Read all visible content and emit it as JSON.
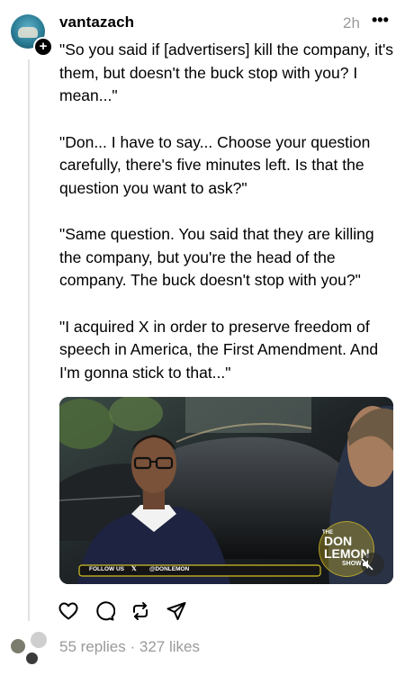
{
  "post": {
    "username": "vantazach",
    "time": "2h",
    "more_icon": "•••",
    "add_icon": "+",
    "paragraphs": [
      "\"So you said if [advertisers] kill the company, it's them, but doesn't the buck stop with you? I mean...\"",
      "\"Don... I have to say... Choose your question carefully, there's five minutes left. Is that the question you want to ask?\"",
      "\"Same question. You said that they are killing the company, but you're the head of the company. The buck doesn't stop with you?\"",
      "\"I acquired X in order to preserve freedom of speech in America, the First Amendment. And I'm gonna stick to that...\""
    ],
    "video": {
      "banner_follow": "FOLLOW US",
      "banner_handle": "@DONLEMON",
      "logo_the": "THE",
      "logo_don": "DON",
      "logo_lemon": "LEMON",
      "logo_show": "SHOW",
      "muted": true
    },
    "replies": "55 replies",
    "separator": "·",
    "likes": "327 likes",
    "icons": [
      "heart-icon",
      "comment-icon",
      "repost-icon",
      "share-icon",
      "mute-icon"
    ]
  }
}
